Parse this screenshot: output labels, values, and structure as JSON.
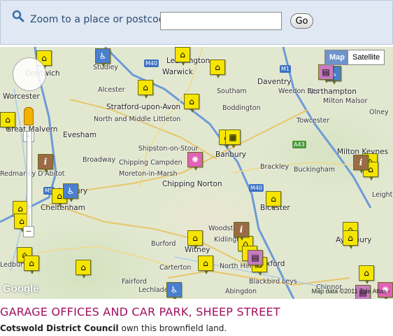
{
  "search": {
    "label": "Zoom to a place or postcode:",
    "input_value": "",
    "input_placeholder": "",
    "go_label": "Go"
  },
  "map": {
    "map_type_options": [
      "Map",
      "Satellite"
    ],
    "selected_map_type": "Map",
    "attribution": "Map data ©2011 Tele Atlas -",
    "logo_text": "Google",
    "places": [
      "Studley",
      "Droitwich",
      "Leamington",
      "Warwick",
      "Daventry",
      "Northampton",
      "Worcester",
      "Alcester",
      "Southam",
      "Weedon Bec",
      "Milton Malsor",
      "Olney",
      "Stratford-upon-Avon",
      "Boddington",
      "North and Middle Littleton",
      "Towcester",
      "Great Malvern",
      "Evesham",
      "Broadway",
      "Chipping Campden",
      "Shipston-on-Stour",
      "Banbury",
      "Brackley",
      "Buckingham",
      "Milton Keynes",
      "Tewkesbury",
      "Moreton-in-Marsh",
      "Chipping Norton",
      "Leighton Buzzard",
      "Cheltenham",
      "Bicester",
      "Woodstock",
      "Kidlington",
      "Aylesbury",
      "Burford",
      "Witney",
      "Carterton",
      "North Hinksey",
      "Oxford",
      "Fairford",
      "Lechlade",
      "Blackbird Leys",
      "Abingdon",
      "Chinnor",
      "Ledbury",
      "Redmarley D'Abitot"
    ],
    "roads": [
      "M40",
      "M1",
      "M40",
      "M5",
      "A43"
    ],
    "zoom_in": "+",
    "zoom_out": "−"
  },
  "site": {
    "title": "GARAGE OFFICES AND CAR PARK, SHEEP STREET",
    "owner_name": "Cotswold District Council",
    "owner_suffix": " own this brownfield land."
  },
  "colors": {
    "title": "#a01060",
    "search_bg": "#dfe8f3",
    "house_marker": "#f5e500",
    "info_marker": "#9a6b45",
    "wheel_marker": "#4a7fd0",
    "atom_marker": "#e062b5"
  },
  "markers": [
    {
      "type": "house",
      "icon": "house-icon"
    },
    {
      "type": "info",
      "icon": "info-icon"
    },
    {
      "type": "wheel",
      "icon": "wheelchair-icon"
    },
    {
      "type": "atom",
      "icon": "atom-icon"
    }
  ]
}
